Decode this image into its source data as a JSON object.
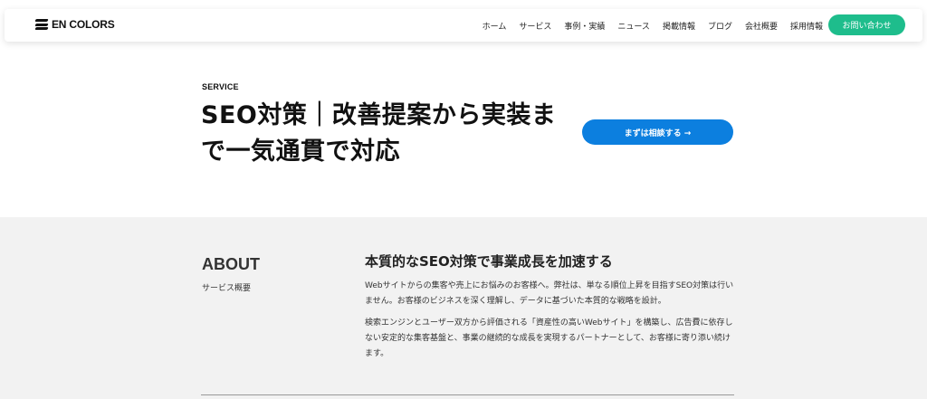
{
  "header": {
    "logo_text": "EN COLORS",
    "nav": [
      "ホーム",
      "サービス",
      "事例・実績",
      "ニュース",
      "掲載情報",
      "ブログ",
      "会社概要",
      "採用情報"
    ],
    "cta_label": "お問い合わせ"
  },
  "hero": {
    "eyebrow": "SERVICE",
    "title_line1": "SEO対策｜改善提案から実装ま",
    "title_line2": "で一気通貫で対応",
    "button_label": "まずは相談する →"
  },
  "about": {
    "heading": "ABOUT",
    "subheading": "サービス概要",
    "title": "本質的なSEO対策で事業成長を加速する",
    "paragraph1": "Webサイトからの集客や売上にお悩みのお客様へ。弊社は、単なる順位上昇を目指すSEO対策は行いません。お客様のビジネスを深く理解し、データに基づいた本質的な戦略を設計。",
    "paragraph2": "検索エンジンとユーザー双方から評価される「資産性の高いWebサイト」を構築し、広告費に依存しない安定的な集客基盤と、事業の継続的な成長を実現するパートナーとして、お客様に寄り添い続けます。"
  },
  "colors": {
    "cta_green": "#1ebd8c",
    "consult_blue": "#0c7fdf",
    "section_gray": "#f2f2f2"
  }
}
